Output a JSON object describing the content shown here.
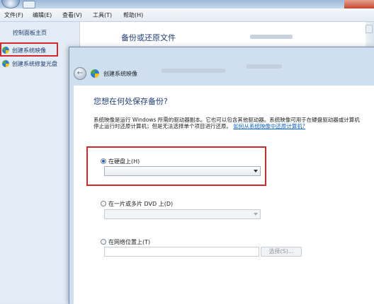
{
  "window": {
    "menu": [
      "文件(F)",
      "编辑(E)",
      "查看(V)",
      "工具(T)",
      "帮助(H)"
    ]
  },
  "nav": {
    "home": "控制面板主页",
    "items": [
      {
        "label": "创建系统映像",
        "icon": "shield-icon"
      },
      {
        "label": "创建系统修复光盘",
        "icon": "shield-icon"
      }
    ]
  },
  "main": {
    "heading": "备份或还原文件"
  },
  "dialog": {
    "title": "创建系统映像",
    "question": "您想在何处保存备份?",
    "description": "系统映像是运行 Windows 所需的驱动器副本。它也可以包含其他驱动器。系统映像可用于在硬盘驱动器或计算机停止运行时还原计算机；但是无法选择单个项目进行还原。",
    "description_link": "如何从系统映像中还原计算机?",
    "options": [
      {
        "label": "在硬盘上(H)",
        "selected": true
      },
      {
        "label": "在一片或多片 DVD 上(D)",
        "selected": false
      },
      {
        "label": "在网络位置上(T)",
        "selected": false
      }
    ],
    "browse_label": "选择(S)..."
  },
  "colors": {
    "highlight_box": "#d12a2a",
    "link": "#0b66d0",
    "heading": "#1e3d78"
  }
}
